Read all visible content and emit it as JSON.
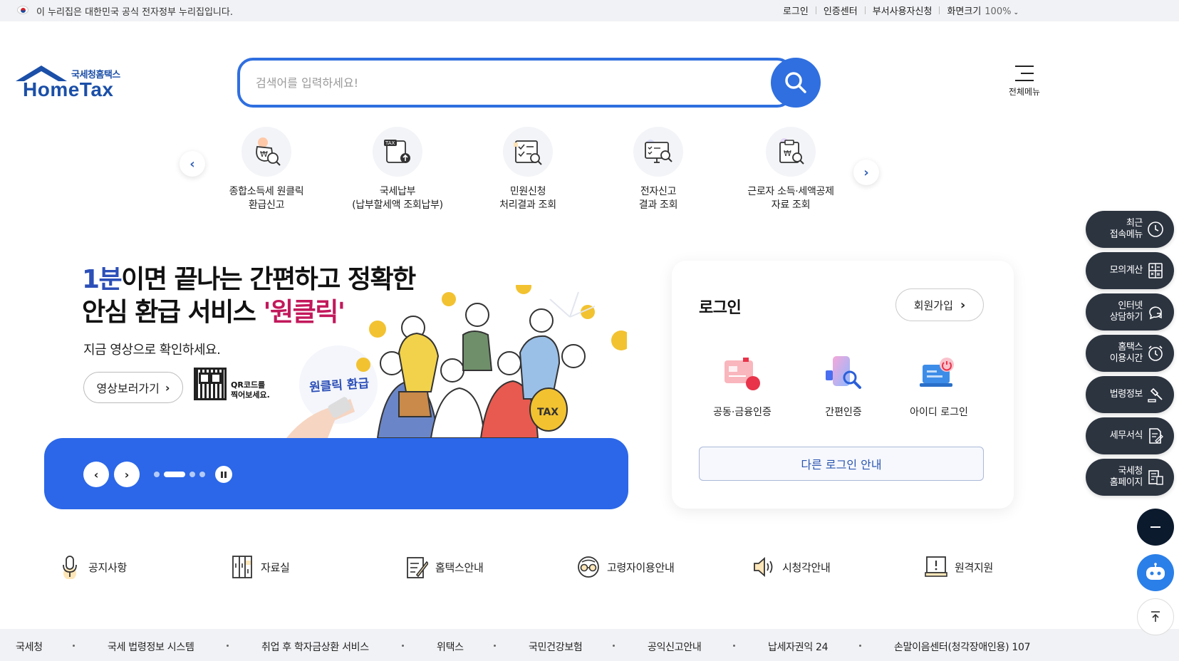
{
  "gov_banner": {
    "flag_icon": "korea-flag-icon",
    "notice": "이 누리집은 대한민국 공식 전자정부 누리집입니다.",
    "links": [
      "로그인",
      "인증센터",
      "부서사용자신청"
    ],
    "zoom_label": "화면크기",
    "zoom_value": "100%"
  },
  "header": {
    "logo_sub": "국세청홈택스",
    "logo_main": "HomeTax",
    "search_placeholder": "검색어를 입력하세요!",
    "all_menu_label": "전체메뉴"
  },
  "quick_services": [
    {
      "line1": "종합소득세 원클릭",
      "line2": "환급신고",
      "icon": "refund-money-bag-icon"
    },
    {
      "line1": "국세납부",
      "line2": "(납부할세액 조회납부)",
      "icon": "tax-payment-document-icon"
    },
    {
      "line1": "민원신청",
      "line2": "처리결과 조회",
      "icon": "civil-request-checklist-icon"
    },
    {
      "line1": "전자신고",
      "line2": "결과 조회",
      "icon": "e-filing-monitor-icon"
    },
    {
      "line1": "근로자 소득·세액공제",
      "line2": "자료 조회",
      "icon": "deduction-document-search-icon"
    }
  ],
  "banner": {
    "title_line1_highlight": "1분",
    "title_line1_rest": "이면 끝나는 간편하고 정확한",
    "title_line2_rest": "안심 환급 서비스 ",
    "title_line2_highlight": "'원클릭'",
    "subtitle": "지금 영상으로 확인하세요.",
    "video_button": "영상보러가기",
    "qr_caption_line1": "QR코드를",
    "qr_caption_line2": "찍어보세요.",
    "illustration_badge": "원클릭 환급",
    "bag_label": "TAX",
    "slide_count": 4,
    "active_slide": 2
  },
  "login": {
    "title": "로그인",
    "join_button": "회원가입",
    "methods": [
      {
        "label": "공동·금융인증",
        "icon": "certificate-card-icon"
      },
      {
        "label": "간편인증",
        "icon": "simple-auth-phone-icon"
      },
      {
        "label": "아이디 로그인",
        "icon": "id-login-laptop-icon"
      }
    ],
    "other_login_button": "다른 로그인 안내"
  },
  "shortcuts": [
    {
      "label": "공지사항",
      "icon": "microphone-icon"
    },
    {
      "label": "자료실",
      "icon": "archive-cabinet-icon"
    },
    {
      "label": "홈택스안내",
      "icon": "guide-document-pen-icon"
    },
    {
      "label": "고령자이용안내",
      "icon": "senior-glasses-icon"
    },
    {
      "label": "시청각안내",
      "icon": "speaker-icon"
    },
    {
      "label": "원격지원",
      "icon": "remote-support-monitor-icon"
    }
  ],
  "footer_links": [
    "국세청",
    "국세 법령정보 시스템",
    "취업 후 학자금상환 서비스",
    "위택스",
    "국민건강보험",
    "공익신고안내",
    "납세자권익 24",
    "손말이음센터(청각장애인용) 107"
  ],
  "right_quick": [
    {
      "label": "최근\n접속메뉴",
      "icon": "clock-icon"
    },
    {
      "label": "모의계산",
      "icon": "calculator-icon"
    },
    {
      "label": "인터넷\n상담하기",
      "icon": "chat-bubble-icon"
    },
    {
      "label": "홈택스\n이용시간",
      "icon": "alarm-clock-icon"
    },
    {
      "label": "법령정보",
      "icon": "gavel-icon"
    },
    {
      "label": "세무서식",
      "icon": "form-document-icon"
    },
    {
      "label": "국세청\n홈페이지",
      "icon": "building-document-icon"
    }
  ],
  "colors": {
    "primary_blue": "#2f6fe0",
    "banner_blue": "#2b67e8",
    "logo_blue": "#1b4fa8",
    "quick_bar_dark": "#2c3440"
  }
}
